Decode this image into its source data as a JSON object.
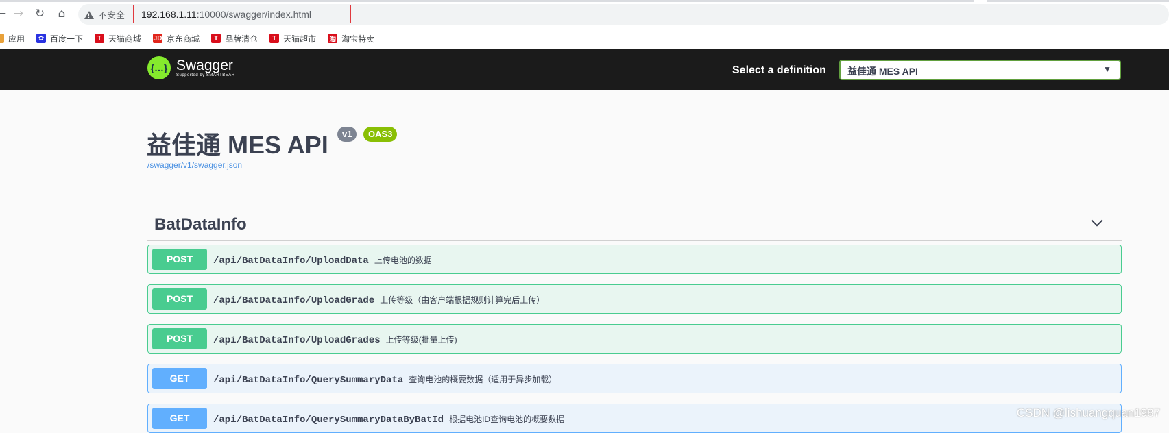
{
  "browser": {
    "security_label": "不安全",
    "url_host": "192.168.1.11",
    "url_rest": ":10000/swagger/index.html"
  },
  "bookmarks": [
    {
      "label": "应用",
      "icon": "apps-icon",
      "color": "#e8a13a"
    },
    {
      "label": "百度一下",
      "icon": "baidu-icon",
      "color": "#2932e1"
    },
    {
      "label": "天猫商城",
      "icon": "tmall-icon",
      "color": "#d90e1b"
    },
    {
      "label": "京东商城",
      "icon": "jd-icon",
      "color": "#e1251b"
    },
    {
      "label": "品牌清仓",
      "icon": "tmall-icon",
      "color": "#d90e1b"
    },
    {
      "label": "天猫超市",
      "icon": "tmall-icon",
      "color": "#d90e1b"
    },
    {
      "label": "淘宝特卖",
      "icon": "taobao-icon",
      "color": "#d90e1b"
    }
  ],
  "topbar": {
    "logo_title": "Swagger",
    "logo_sub": "Supported by SMARTBEAR",
    "definition_label": "Select a definition",
    "definition_value": "益佳通 MES API"
  },
  "info": {
    "title": "益佳通 MES API",
    "version_badge": "v1",
    "oas_badge": "OAS3",
    "spec_url": "/swagger/v1/swagger.json"
  },
  "tag": {
    "name": "BatDataInfo"
  },
  "operations": [
    {
      "method": "POST",
      "path": "/api/BatDataInfo/UploadData",
      "summary": "上传电池的数据"
    },
    {
      "method": "POST",
      "path": "/api/BatDataInfo/UploadGrade",
      "summary": "上传等级（由客户端根据规则计算完后上传）"
    },
    {
      "method": "POST",
      "path": "/api/BatDataInfo/UploadGrades",
      "summary": "上传等级(批量上传)"
    },
    {
      "method": "GET",
      "path": "/api/BatDataInfo/QuerySummaryData",
      "summary": "查询电池的概要数据（适用于异步加载）"
    },
    {
      "method": "GET",
      "path": "/api/BatDataInfo/QuerySummaryDataByBatId",
      "summary": "根据电池ID查询电池的概要数据"
    }
  ],
  "watermark": "CSDN @lishuangquan1987"
}
